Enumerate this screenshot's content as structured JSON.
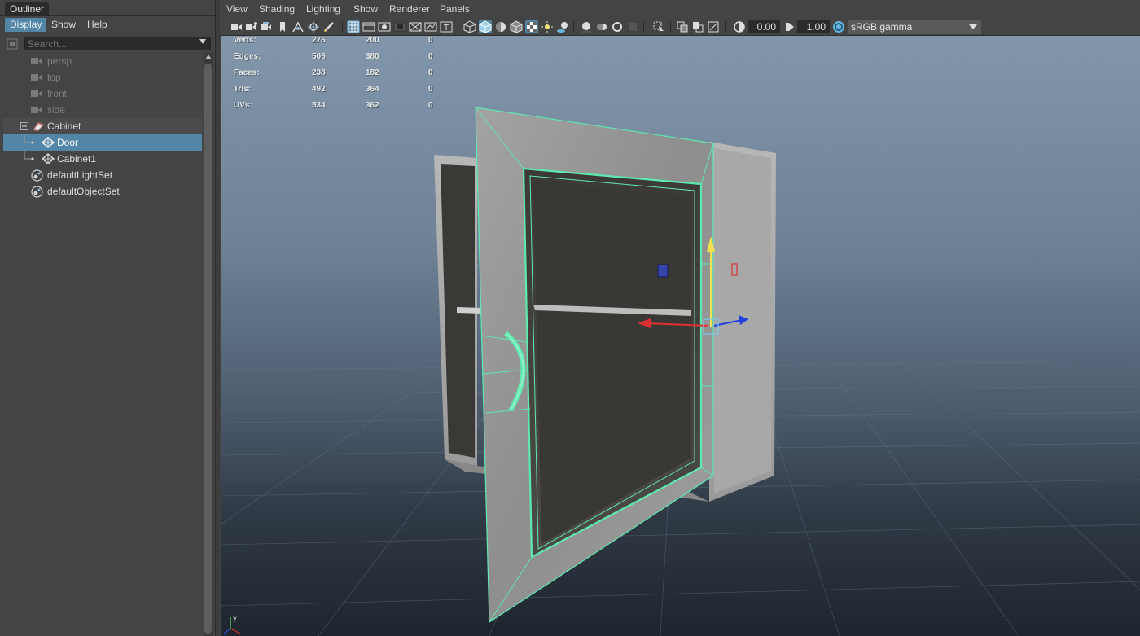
{
  "outliner": {
    "title": "Outliner",
    "menu": [
      "Display",
      "Show",
      "Help"
    ],
    "search_placeholder": "Search...",
    "items": [
      {
        "label": "persp",
        "type": "camera",
        "dim": true
      },
      {
        "label": "top",
        "type": "camera",
        "dim": true
      },
      {
        "label": "front",
        "type": "camera",
        "dim": true
      },
      {
        "label": "side",
        "type": "camera",
        "dim": true
      },
      {
        "label": "Cabinet",
        "type": "group"
      },
      {
        "label": "Door",
        "type": "mesh",
        "selected": true
      },
      {
        "label": "Cabinet1",
        "type": "mesh"
      },
      {
        "label": "defaultLightSet",
        "type": "set"
      },
      {
        "label": "defaultObjectSet",
        "type": "set"
      }
    ]
  },
  "viewport": {
    "menu": [
      "View",
      "Shading",
      "Lighting",
      "Show",
      "Renderer",
      "Panels"
    ],
    "toolbar": {
      "exposure": "0.00",
      "gamma": "1.00",
      "color_management": "sRGB gamma"
    },
    "hud": [
      {
        "label": "Verts:",
        "values": [
          "276",
          "200",
          "0"
        ]
      },
      {
        "label": "Edges:",
        "values": [
          "506",
          "380",
          "0"
        ]
      },
      {
        "label": "Faces:",
        "values": [
          "238",
          "182",
          "0"
        ]
      },
      {
        "label": "Tris:",
        "values": [
          "492",
          "364",
          "0"
        ]
      },
      {
        "label": "UVs:",
        "values": [
          "534",
          "362",
          "0"
        ]
      }
    ]
  },
  "colors": {
    "selection": "#5285a6",
    "wireframe_highlight": "#5fe8b0",
    "panel_bg": "#444444"
  }
}
